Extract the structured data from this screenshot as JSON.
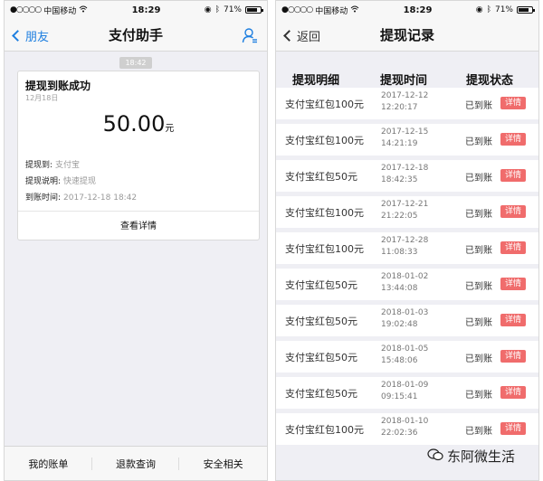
{
  "left": {
    "status": {
      "carrier": "中国移动",
      "time": "18:29",
      "battery": "71%"
    },
    "nav": {
      "back_label": "朋友",
      "title": "支付助手"
    },
    "time_chip": "18:42",
    "card": {
      "title": "提现到账成功",
      "date": "12月18日",
      "amount": "50.00",
      "currency": "元",
      "fields": [
        {
          "key": "提现到:",
          "value": "支付宝"
        },
        {
          "key": "提现说明:",
          "value": "快速提现"
        },
        {
          "key": "到账时间:",
          "value": "2017-12-18 18:42"
        }
      ],
      "link": "查看详情"
    },
    "bottom_tabs": [
      "我的账单",
      "退款查询",
      "安全相关"
    ]
  },
  "right": {
    "status": {
      "carrier": "中国移动",
      "time": "18:29",
      "battery": "71%"
    },
    "nav": {
      "back_label": "返回",
      "title": "提现记录"
    },
    "headers": [
      "提现明细",
      "提现时间",
      "提现状态"
    ],
    "records": [
      {
        "desc": "支付宝红包100元",
        "date": "2017-12-12",
        "time": "12:20:17",
        "status": "已到账",
        "action": "详情"
      },
      {
        "desc": "支付宝红包100元",
        "date": "2017-12-15",
        "time": "14:21:19",
        "status": "已到账",
        "action": "详情"
      },
      {
        "desc": "支付宝红包50元",
        "date": "2017-12-18",
        "time": "18:42:35",
        "status": "已到账",
        "action": "详情"
      },
      {
        "desc": "支付宝红包100元",
        "date": "2017-12-21",
        "time": "21:22:05",
        "status": "已到账",
        "action": "详情"
      },
      {
        "desc": "支付宝红包100元",
        "date": "2017-12-28",
        "time": "11:08:33",
        "status": "已到账",
        "action": "详情"
      },
      {
        "desc": "支付宝红包50元",
        "date": "2018-01-02",
        "time": "13:44:08",
        "status": "已到账",
        "action": "详情"
      },
      {
        "desc": "支付宝红包50元",
        "date": "2018-01-03",
        "time": "19:02:48",
        "status": "已到账",
        "action": "详情"
      },
      {
        "desc": "支付宝红包50元",
        "date": "2018-01-05",
        "time": "15:48:06",
        "status": "已到账",
        "action": "详情"
      },
      {
        "desc": "支付宝红包50元",
        "date": "2018-01-09",
        "time": "09:15:41",
        "status": "已到账",
        "action": "详情"
      },
      {
        "desc": "支付宝红包100元",
        "date": "2018-01-10",
        "time": "22:02:36",
        "status": "已到账",
        "action": "详情"
      }
    ]
  },
  "watermark": "东阿微生活",
  "colors": {
    "accent_blue": "#1e7fe0",
    "detail_red": "#f06c6c"
  }
}
